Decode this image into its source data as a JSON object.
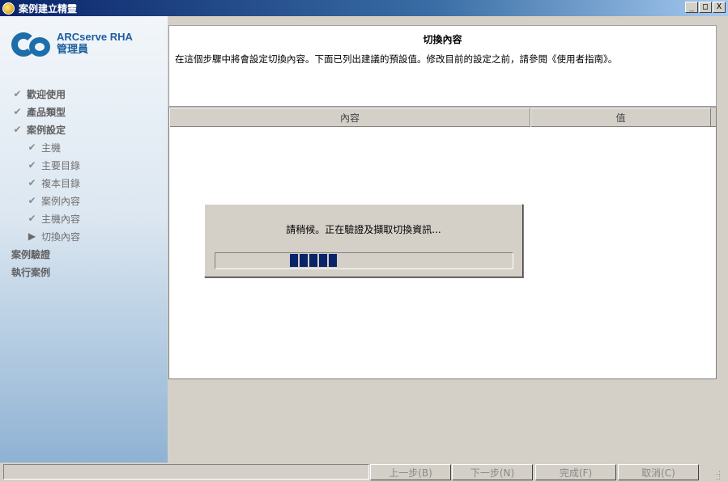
{
  "window": {
    "title": "案例建立精靈",
    "controls": {
      "minimize": "_",
      "restore": "□",
      "close": "X"
    }
  },
  "logo": {
    "line1": "ARCserve RHA",
    "line2": "管理員",
    "mark_color": "#1d6eaa"
  },
  "steps": [
    {
      "label": "歡迎使用",
      "level": 0,
      "status": "done"
    },
    {
      "label": "產品類型",
      "level": 0,
      "status": "done"
    },
    {
      "label": "案例設定",
      "level": 0,
      "status": "done"
    },
    {
      "label": "主機",
      "level": 1,
      "status": "done"
    },
    {
      "label": "主要目錄",
      "level": 1,
      "status": "done"
    },
    {
      "label": "複本目錄",
      "level": 1,
      "status": "done"
    },
    {
      "label": "案例內容",
      "level": 1,
      "status": "done"
    },
    {
      "label": "主機內容",
      "level": 1,
      "status": "done"
    },
    {
      "label": "切換內容",
      "level": 1,
      "status": "current"
    },
    {
      "label": "案例驗證",
      "level": 0,
      "status": "pending"
    },
    {
      "label": "執行案例",
      "level": 0,
      "status": "pending"
    }
  ],
  "header": {
    "title": "切換內容",
    "description": "在這個步驟中將會設定切換內容。下面已列出建議的預設值。修改目前的設定之前，請參閱《使用者指南》。"
  },
  "table": {
    "columns": [
      "內容",
      "值"
    ]
  },
  "wait_dialog": {
    "message": "請稍候。正在驗證及擷取切換資訊...",
    "progress_color": "#0a246a"
  },
  "buttons": {
    "back": "上一步(B)",
    "next": "下一步(N)",
    "finish": "完成(F)",
    "cancel": "取消(C)"
  }
}
